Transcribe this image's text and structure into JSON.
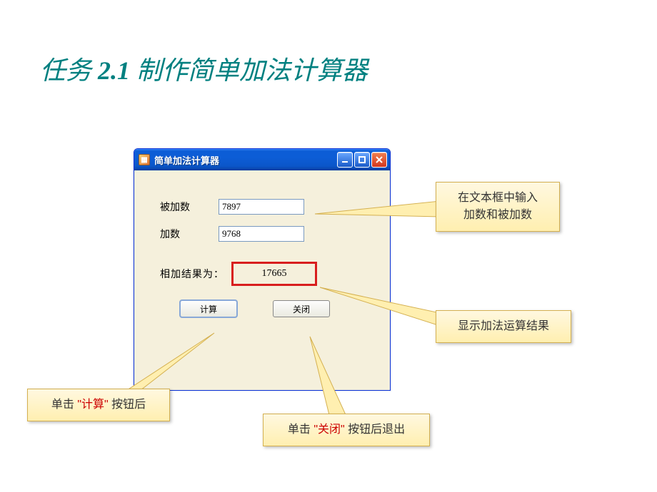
{
  "slide": {
    "title_prefix": "任务 ",
    "title_num": "2.1",
    "title_suffix": " 制作简单加法计算器"
  },
  "window": {
    "title": "简单加法计算器",
    "labels": {
      "augend": "被加数",
      "addend": "加数",
      "result": "相加结果为："
    },
    "inputs": {
      "augend": "7897",
      "addend": "9768"
    },
    "result": "17665",
    "buttons": {
      "calc": "计算",
      "close": "关闭"
    }
  },
  "callouts": {
    "c1": "在文本框中输入\n加数和被加数",
    "c2": "显示加法运算结果",
    "c3_pre": "单击",
    "c3_q1": "\"计算\"",
    "c3_post": "按钮后",
    "c4_pre": "单击",
    "c4_q1": "\"关闭\"",
    "c4_post": "按钮后退出"
  }
}
